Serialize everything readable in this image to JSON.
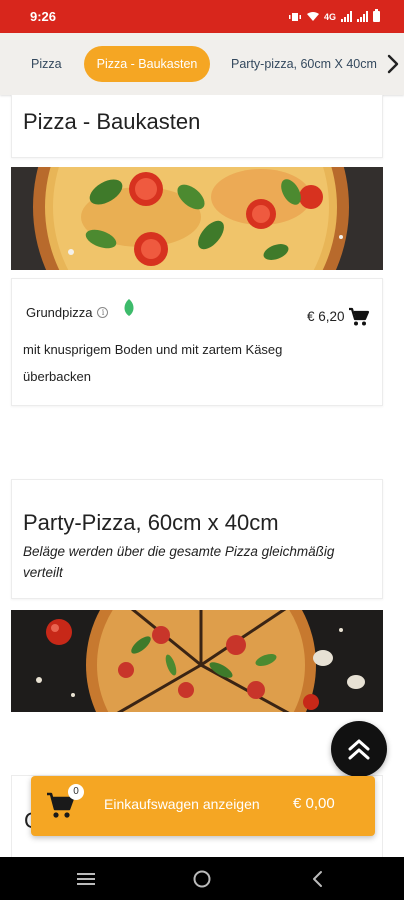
{
  "status_bar": {
    "time": "9:26",
    "network": "4G"
  },
  "tabs": [
    {
      "label": "Pizza"
    },
    {
      "label": "Pizza - Baukasten"
    },
    {
      "label": "Party-pizza, 60cm X 40cm"
    }
  ],
  "sections": {
    "baukasten": {
      "title": "Pizza - Baukasten",
      "product": {
        "name": "Grundpizza",
        "price": "€ 6,20",
        "description": "mit knusprigem Boden und mit zartem Käseg überbacken"
      }
    },
    "party": {
      "title": "Party-Pizza, 60cm x 40cm",
      "subtitle": "Beläge werden über die gesamte Pizza gleichmäßig verteilt"
    },
    "next": {
      "title_partial": "C"
    }
  },
  "cart": {
    "count": "0",
    "label": "Einkaufswagen anzeigen",
    "total": "€ 0,00"
  },
  "icons": {
    "info": "i",
    "leaf": "leaf-icon",
    "cart": "cart-icon",
    "scroll_top": "double-chevron-up-icon"
  },
  "colors": {
    "status_bar": "#d8261c",
    "accent": "#f5a623",
    "tab_text": "#34495e",
    "leaf": "#3dbb6b"
  }
}
